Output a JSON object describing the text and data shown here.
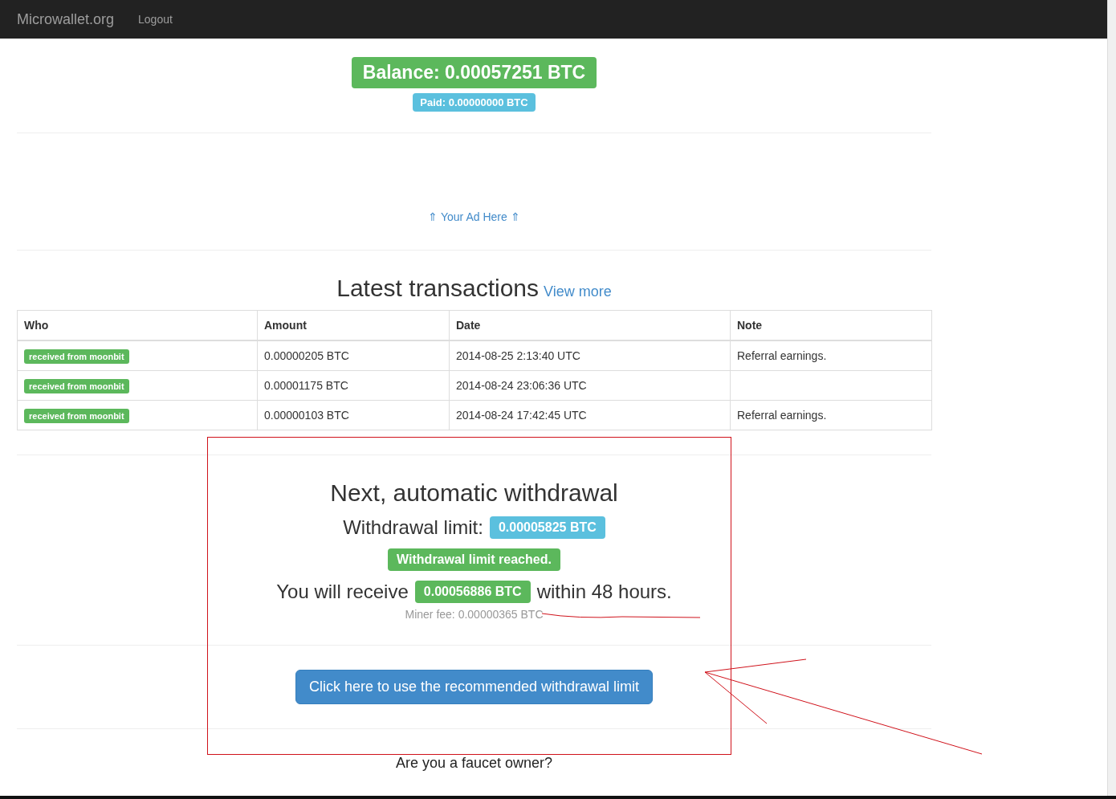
{
  "navbar": {
    "brand": "Microwallet.org",
    "links": [
      "Logout"
    ]
  },
  "balance": {
    "label": "Balance: 0.00057251 BTC",
    "paid": "Paid: 0.00000000 BTC"
  },
  "ad": {
    "link": "⇑ Your Ad Here ⇑"
  },
  "transactions": {
    "title": "Latest transactions",
    "more_link": "View more",
    "columns": [
      "Who",
      "Amount",
      "Date",
      "Note"
    ],
    "rows": [
      {
        "who": "received from moonbit",
        "amount": "0.00000205 BTC",
        "date": "2014-08-25 2:13:40 UTC",
        "note": "Referral earnings."
      },
      {
        "who": "received from moonbit",
        "amount": "0.00001175 BTC",
        "date": "2014-08-24 23:06:36 UTC",
        "note": ""
      },
      {
        "who": "received from moonbit",
        "amount": "0.00000103 BTC",
        "date": "2014-08-24 17:42:45 UTC",
        "note": "Referral earnings."
      }
    ]
  },
  "withdrawal": {
    "title": "Next, automatic withdrawal",
    "limit_label": "Withdrawal limit:",
    "limit_value": "0.00005825 BTC",
    "status": "Withdrawal limit reached.",
    "receive_prefix": "You will receive",
    "receive_value": "0.00056886 BTC",
    "receive_suffix": "within 48 hours.",
    "miner_fee": "Miner fee: 0.00000365 BTC",
    "button": "Click here to use the recommended withdrawal limit"
  },
  "footer": {
    "question": "Are you a faucet owner?"
  }
}
